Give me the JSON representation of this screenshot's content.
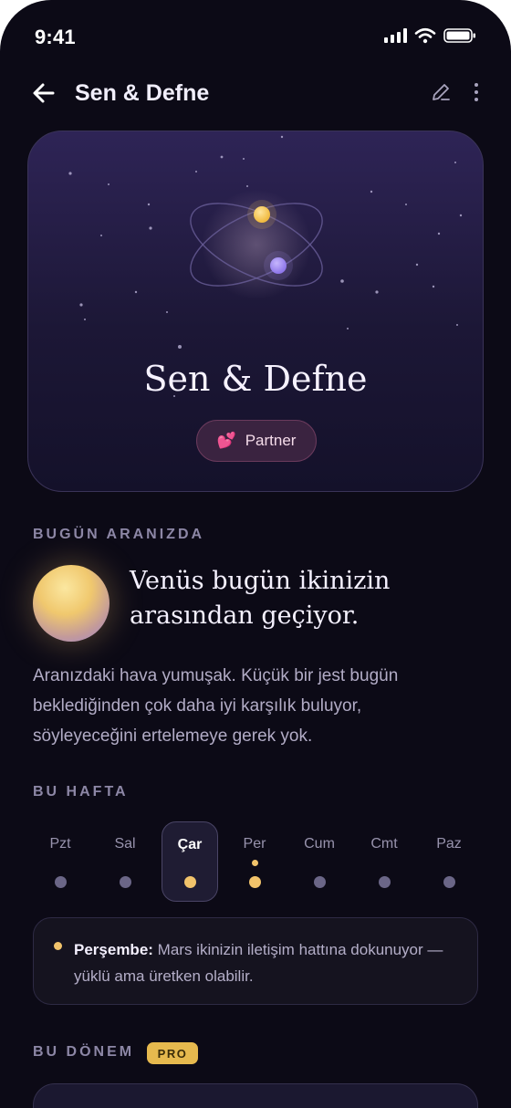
{
  "status": {
    "time": "9:41"
  },
  "nav": {
    "title": "Sen & Defne"
  },
  "hero": {
    "title": "Sen & Defne",
    "chip_emoji": "💕",
    "chip_label": "Partner",
    "planet_colors": [
      "#f5c75c",
      "#a591f0"
    ]
  },
  "today": {
    "label": "BUGÜN ARANIZDA",
    "headline": "Venüs bugün ikinizin arasından geçiyor.",
    "body": "Aranızdaki hava yumuşak. Küçük bir jest bugün beklediğinden çok daha iyi karşılık buluyor, söyleyeceğini ertelemeye gerek yok."
  },
  "week": {
    "label": "BU HAFTA",
    "days": [
      {
        "name": "Pzt",
        "active": false,
        "dot": "dim",
        "marker": false
      },
      {
        "name": "Sal",
        "active": false,
        "dot": "dim",
        "marker": false
      },
      {
        "name": "Çar",
        "active": true,
        "dot": "gold",
        "marker": false
      },
      {
        "name": "Per",
        "active": false,
        "dot": "gold",
        "marker": true
      },
      {
        "name": "Cum",
        "active": false,
        "dot": "dim",
        "marker": false
      },
      {
        "name": "Cmt",
        "active": false,
        "dot": "dim",
        "marker": false
      },
      {
        "name": "Paz",
        "active": false,
        "dot": "dim",
        "marker": false
      }
    ],
    "note_day": "Perşembe:",
    "note_text": " Mars ikinizin iletişim hattına dokunuyor — yüklü ama üretken olabilir."
  },
  "period": {
    "label": "BU DÖNEM",
    "badge": "PRO"
  },
  "colors": {
    "background": "#0c0a16",
    "gold": "#f1c36b",
    "muted_dot": "#6b6687"
  }
}
